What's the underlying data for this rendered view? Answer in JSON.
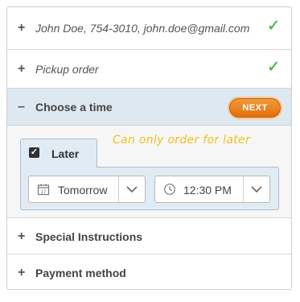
{
  "contact": {
    "toggle": "+",
    "summary": "John Doe, 754-3010, john.doe@gmail.com",
    "status_icon": "check-icon"
  },
  "pickup": {
    "toggle": "+",
    "summary": "Pickup order",
    "status_icon": "check-icon"
  },
  "choose_time": {
    "toggle": "–",
    "title": "Choose a time",
    "next_label": "NEXT",
    "note": "Can only order for later",
    "later": {
      "label": "Later",
      "checked": true
    },
    "day_select": {
      "value": "Tomorrow",
      "icon": "calendar-icon"
    },
    "time_select": {
      "value": "12:30 PM",
      "icon": "clock-icon"
    }
  },
  "special_instructions": {
    "toggle": "+",
    "title": "Special Instructions"
  },
  "payment": {
    "toggle": "+",
    "title": "Payment method"
  },
  "colors": {
    "accent": "#e8800f",
    "check": "#5cb85c",
    "note": "#f0c020",
    "active_header": "#dde8f1"
  }
}
